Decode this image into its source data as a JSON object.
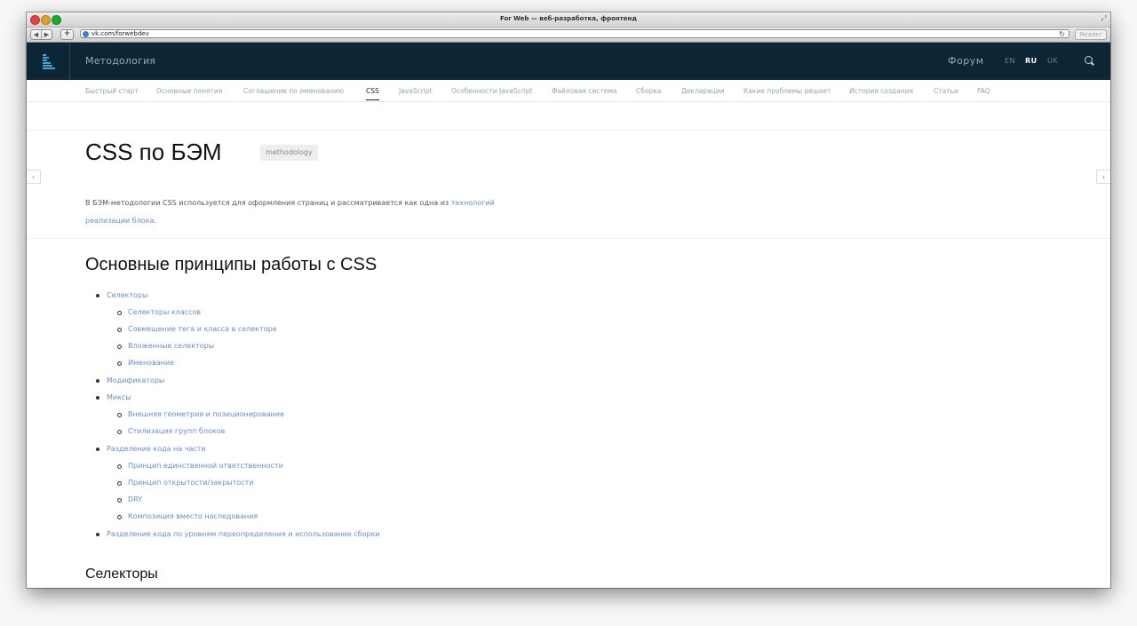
{
  "browser": {
    "window_title": "For Web — веб-разработка, фронтенд",
    "url": "vk.com/forwebdev",
    "reader_label": "Reader",
    "back_glyph": "◀",
    "forward_glyph": "▶",
    "plus_glyph": "+",
    "reload_glyph": "↻",
    "fullscreen_glyph": "⤢"
  },
  "header": {
    "title": "Методология",
    "forum": "Форум",
    "langs": [
      "EN",
      "RU",
      "UK"
    ]
  },
  "nav": {
    "items": [
      "Быстрый старт",
      "Основные понятия",
      "Соглашение по именованию",
      "CSS",
      "JavaScript",
      "Особенности JavaScript",
      "Файловая система",
      "Сборка",
      "Декларации",
      "Какие проблемы решает",
      "История создания",
      "Статьи",
      "FAQ"
    ],
    "active_index": 3
  },
  "page": {
    "title": "CSS по БЭМ",
    "tag": "methodology",
    "intro_text": "В БЭМ-методологии CSS используется для оформления страниц и рассматривается как одна из ",
    "intro_link": "технологий реализации блока",
    "intro_end": ".",
    "section_title": "Основные принципы работы с CSS",
    "toc": [
      {
        "label": "Селекторы",
        "level": 1
      },
      {
        "label": "Селекторы классов",
        "level": 2
      },
      {
        "label": "Совмещение тега и класса в селекторе",
        "level": 2
      },
      {
        "label": "Вложенные селекторы",
        "level": 2
      },
      {
        "label": "Именование",
        "level": 2
      },
      {
        "label": "Модификаторы",
        "level": 1
      },
      {
        "label": "Миксы",
        "level": 1
      },
      {
        "label": "Внешняя геометрия и позиционирование",
        "level": 2
      },
      {
        "label": "Стилизация групп блоков",
        "level": 2
      },
      {
        "label": "Разделение кода на части",
        "level": 1
      },
      {
        "label": "Принцип единственной ответственности",
        "level": 2
      },
      {
        "label": "Принцип открытости/закрытости",
        "level": 2
      },
      {
        "label": "DRY",
        "level": 2
      },
      {
        "label": "Композиция вместо наследования",
        "level": 2
      },
      {
        "label": "Разделение кода по уровням переопределения и использование сборки",
        "level": 1
      }
    ],
    "next_heading": "Селекторы",
    "prev_arrow": "‹",
    "next_arrow": "›"
  },
  "colors": {
    "header_bg": "#0c2636",
    "link": "#6a8cc8",
    "logo_accent": "#3aa6dc"
  }
}
